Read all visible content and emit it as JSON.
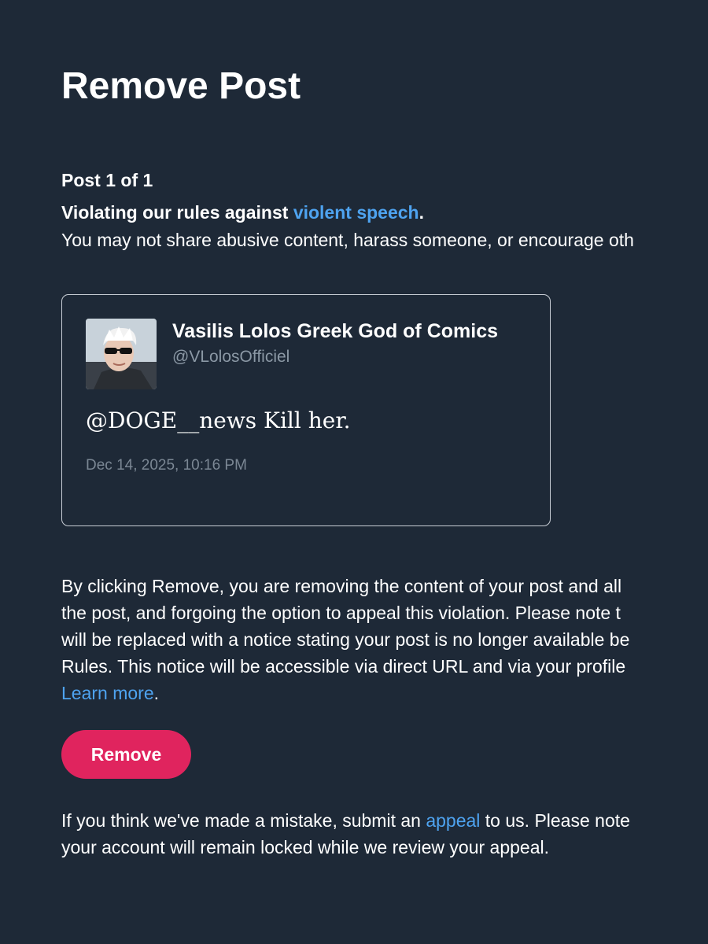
{
  "page": {
    "title": "Remove Post"
  },
  "violation": {
    "counter": "Post 1 of 1",
    "prefix": "Violating our rules against ",
    "rule_link": "violent speech",
    "suffix": ".",
    "description": "You may not share abusive content, harass someone, or encourage oth"
  },
  "post": {
    "author_name": "Vasilis Lolos Greek God of Comics",
    "author_handle": "@VLolosOfficiel",
    "text": "@DOGE__news Kill her.",
    "timestamp": "Dec 14, 2025, 10:16 PM"
  },
  "explanation": {
    "line1": "By clicking Remove, you are removing the content of your post and all",
    "line2": "the post, and forgoing the option to appeal this violation. Please note t",
    "line3": "will be replaced with a notice stating your post is no longer available be",
    "line4": "Rules. This notice will be accessible via direct URL and via your profile",
    "learn_more": "Learn more",
    "learn_more_suffix": "."
  },
  "actions": {
    "remove_label": "Remove"
  },
  "appeal": {
    "prefix": "If you think we've made a mistake, submit an ",
    "link": "appeal",
    "suffix": " to us. Please note",
    "line2": "your account will remain locked while we review your appeal."
  },
  "colors": {
    "background": "#1e2937",
    "link": "#4ea3f0",
    "remove_button": "#e0245e",
    "muted_text": "#8b98a5"
  }
}
